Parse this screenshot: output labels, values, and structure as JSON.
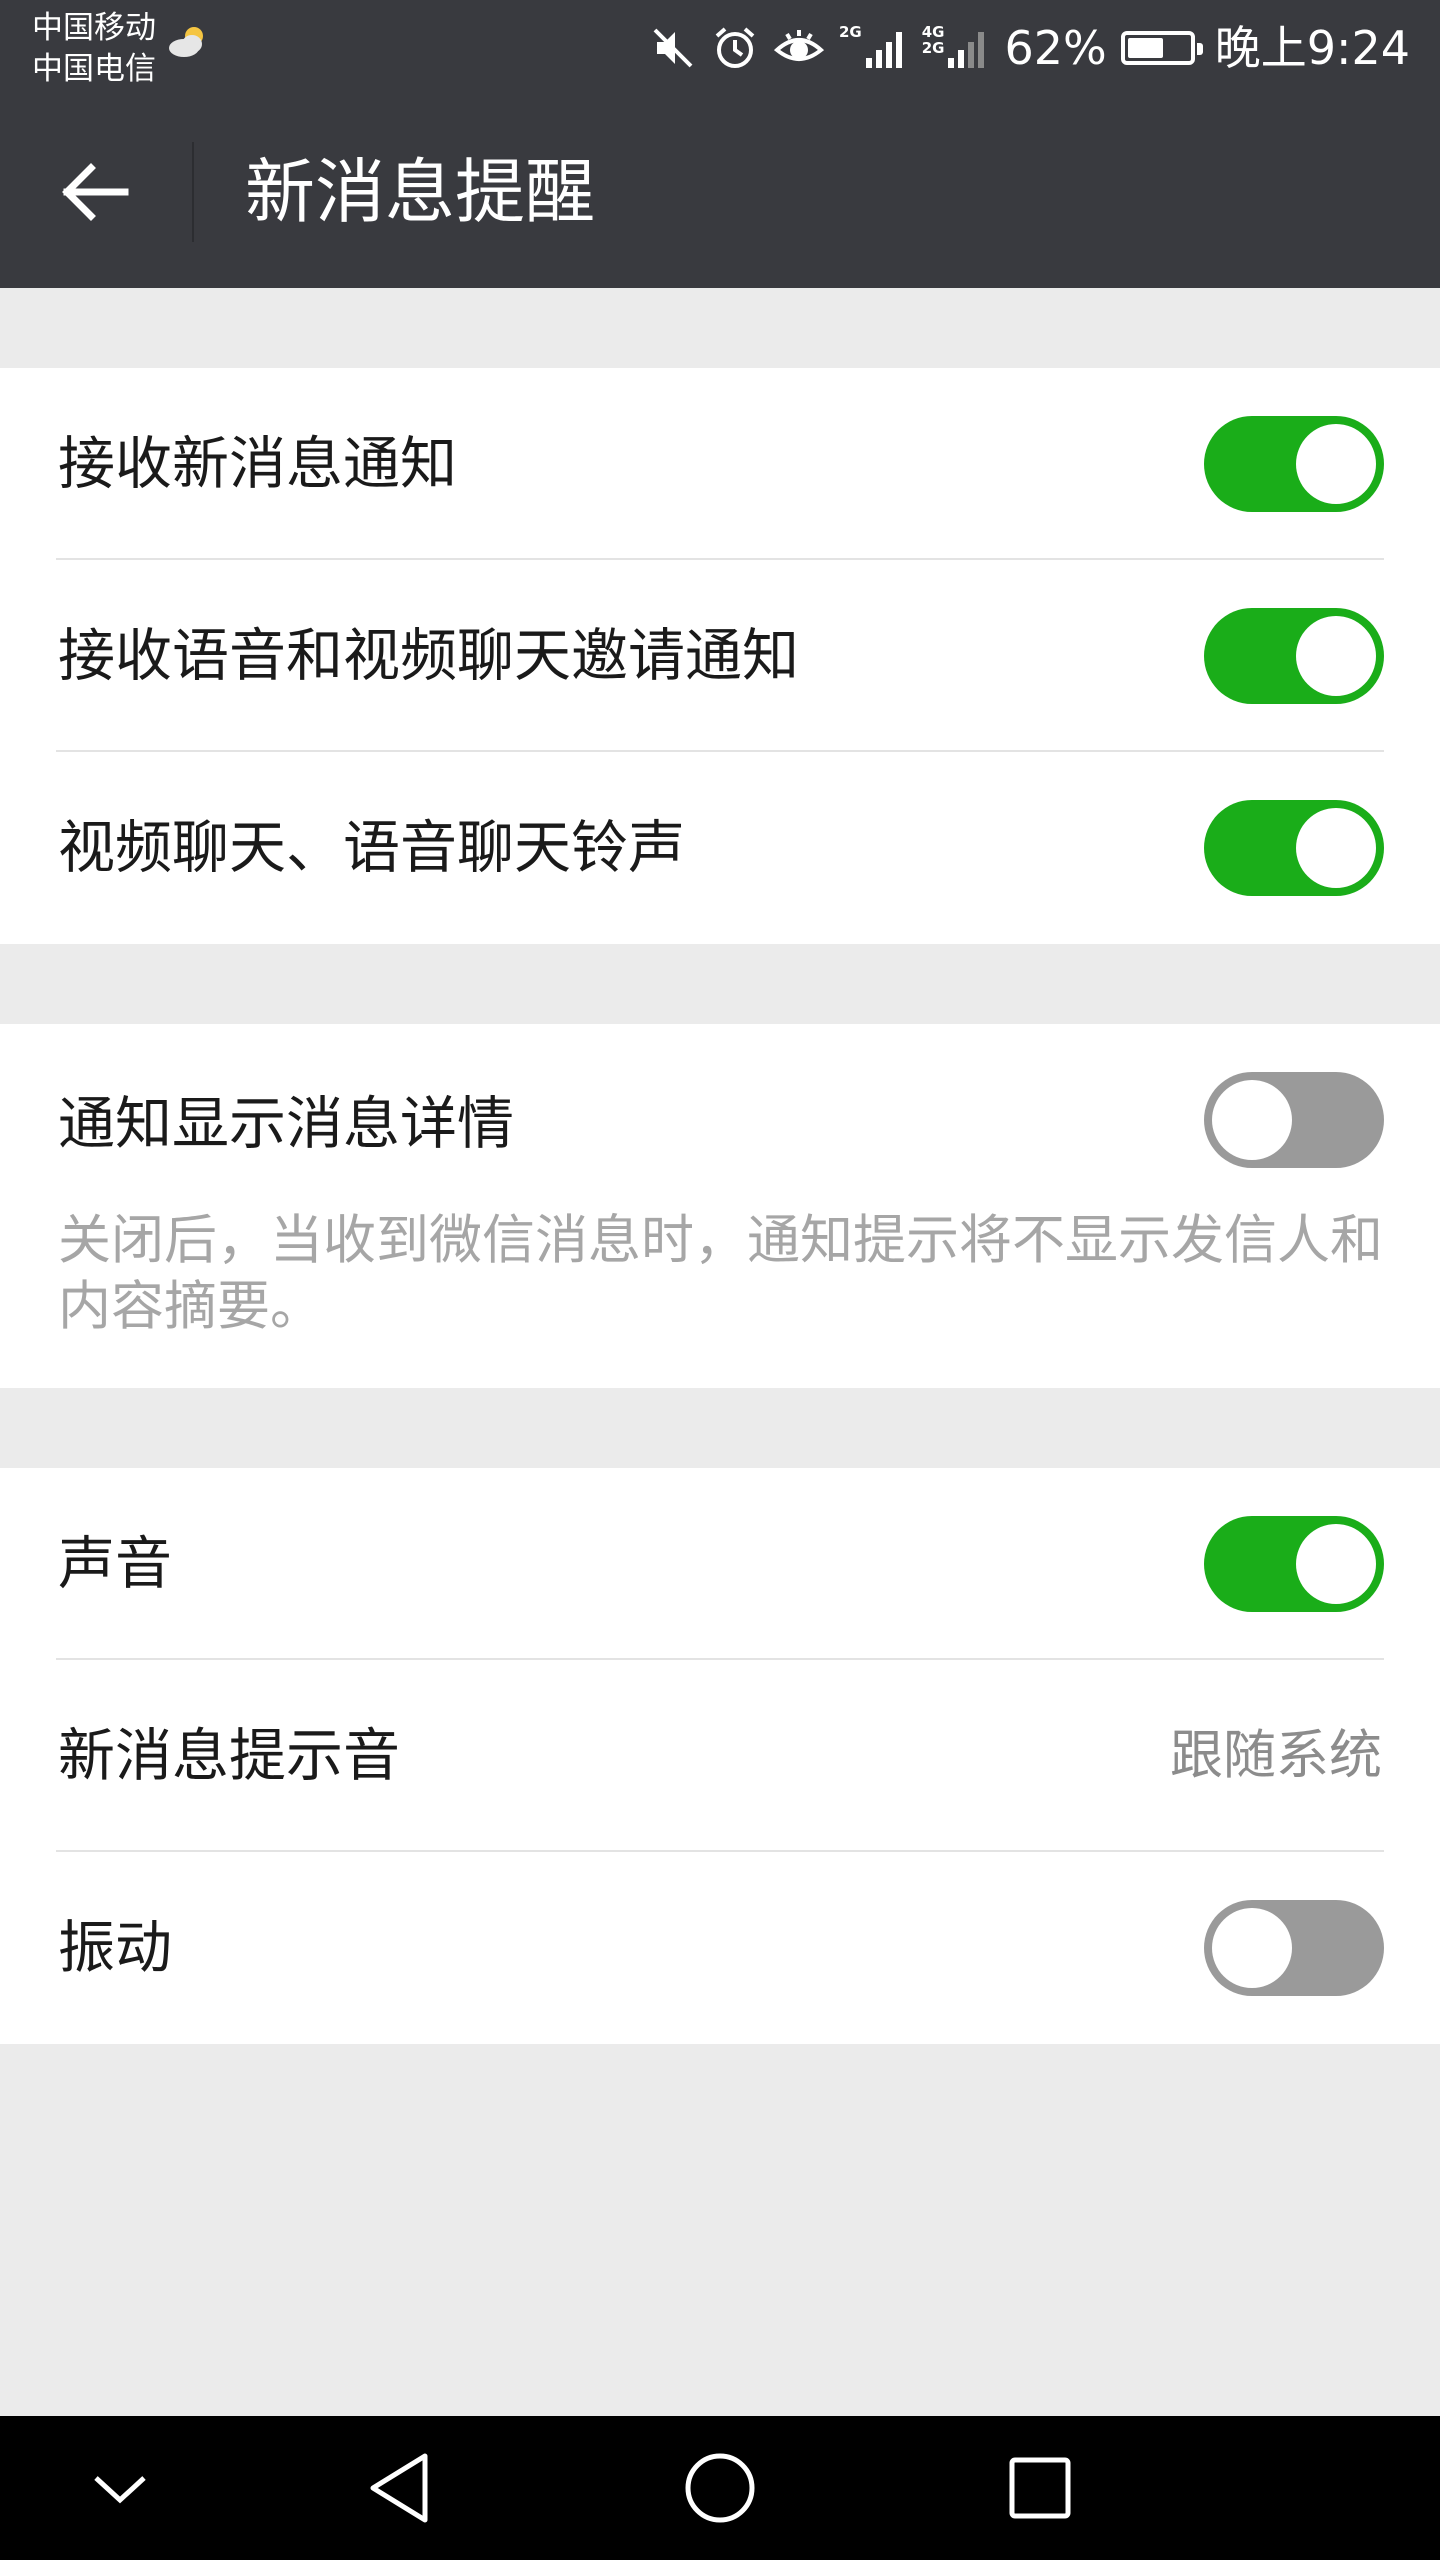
{
  "status_bar": {
    "carrier_1": "中国移动",
    "carrier_2": "中国电信",
    "weather_icon": "cloud-sun-icon",
    "network_1": "2G",
    "network_2_top": "4G",
    "network_2_bottom": "2G",
    "battery_percent": "62%",
    "battery_level": 0.62,
    "time": "晚上9:24"
  },
  "app_bar": {
    "title": "新消息提醒",
    "back_icon": "back-arrow-icon"
  },
  "settings": {
    "receive_notifications": {
      "label": "接收新消息通知",
      "enabled": true
    },
    "call_invite_notifications": {
      "label": "接收语音和视频聊天邀请通知",
      "enabled": true
    },
    "call_ringtone": {
      "label": "视频聊天、语音聊天铃声",
      "enabled": true
    },
    "show_details": {
      "label": "通知显示消息详情",
      "enabled": false,
      "description": "关闭后，当收到微信消息时，通知提示将不显示发信人和内容摘要。"
    },
    "sound": {
      "label": "声音",
      "enabled": true
    },
    "notification_tone": {
      "label": "新消息提示音",
      "value": "跟随系统"
    },
    "vibrate": {
      "label": "振动",
      "enabled": false
    }
  },
  "colors": {
    "toolbar": "#393a3f",
    "toggle_on": "#1aad19",
    "toggle_off": "#9a9a9a",
    "background": "#ebebeb"
  },
  "nav_bar": {
    "collapse_icon": "chevron-down-icon",
    "back_icon": "triangle-back-icon",
    "home_icon": "circle-home-icon",
    "recents_icon": "square-recents-icon"
  }
}
